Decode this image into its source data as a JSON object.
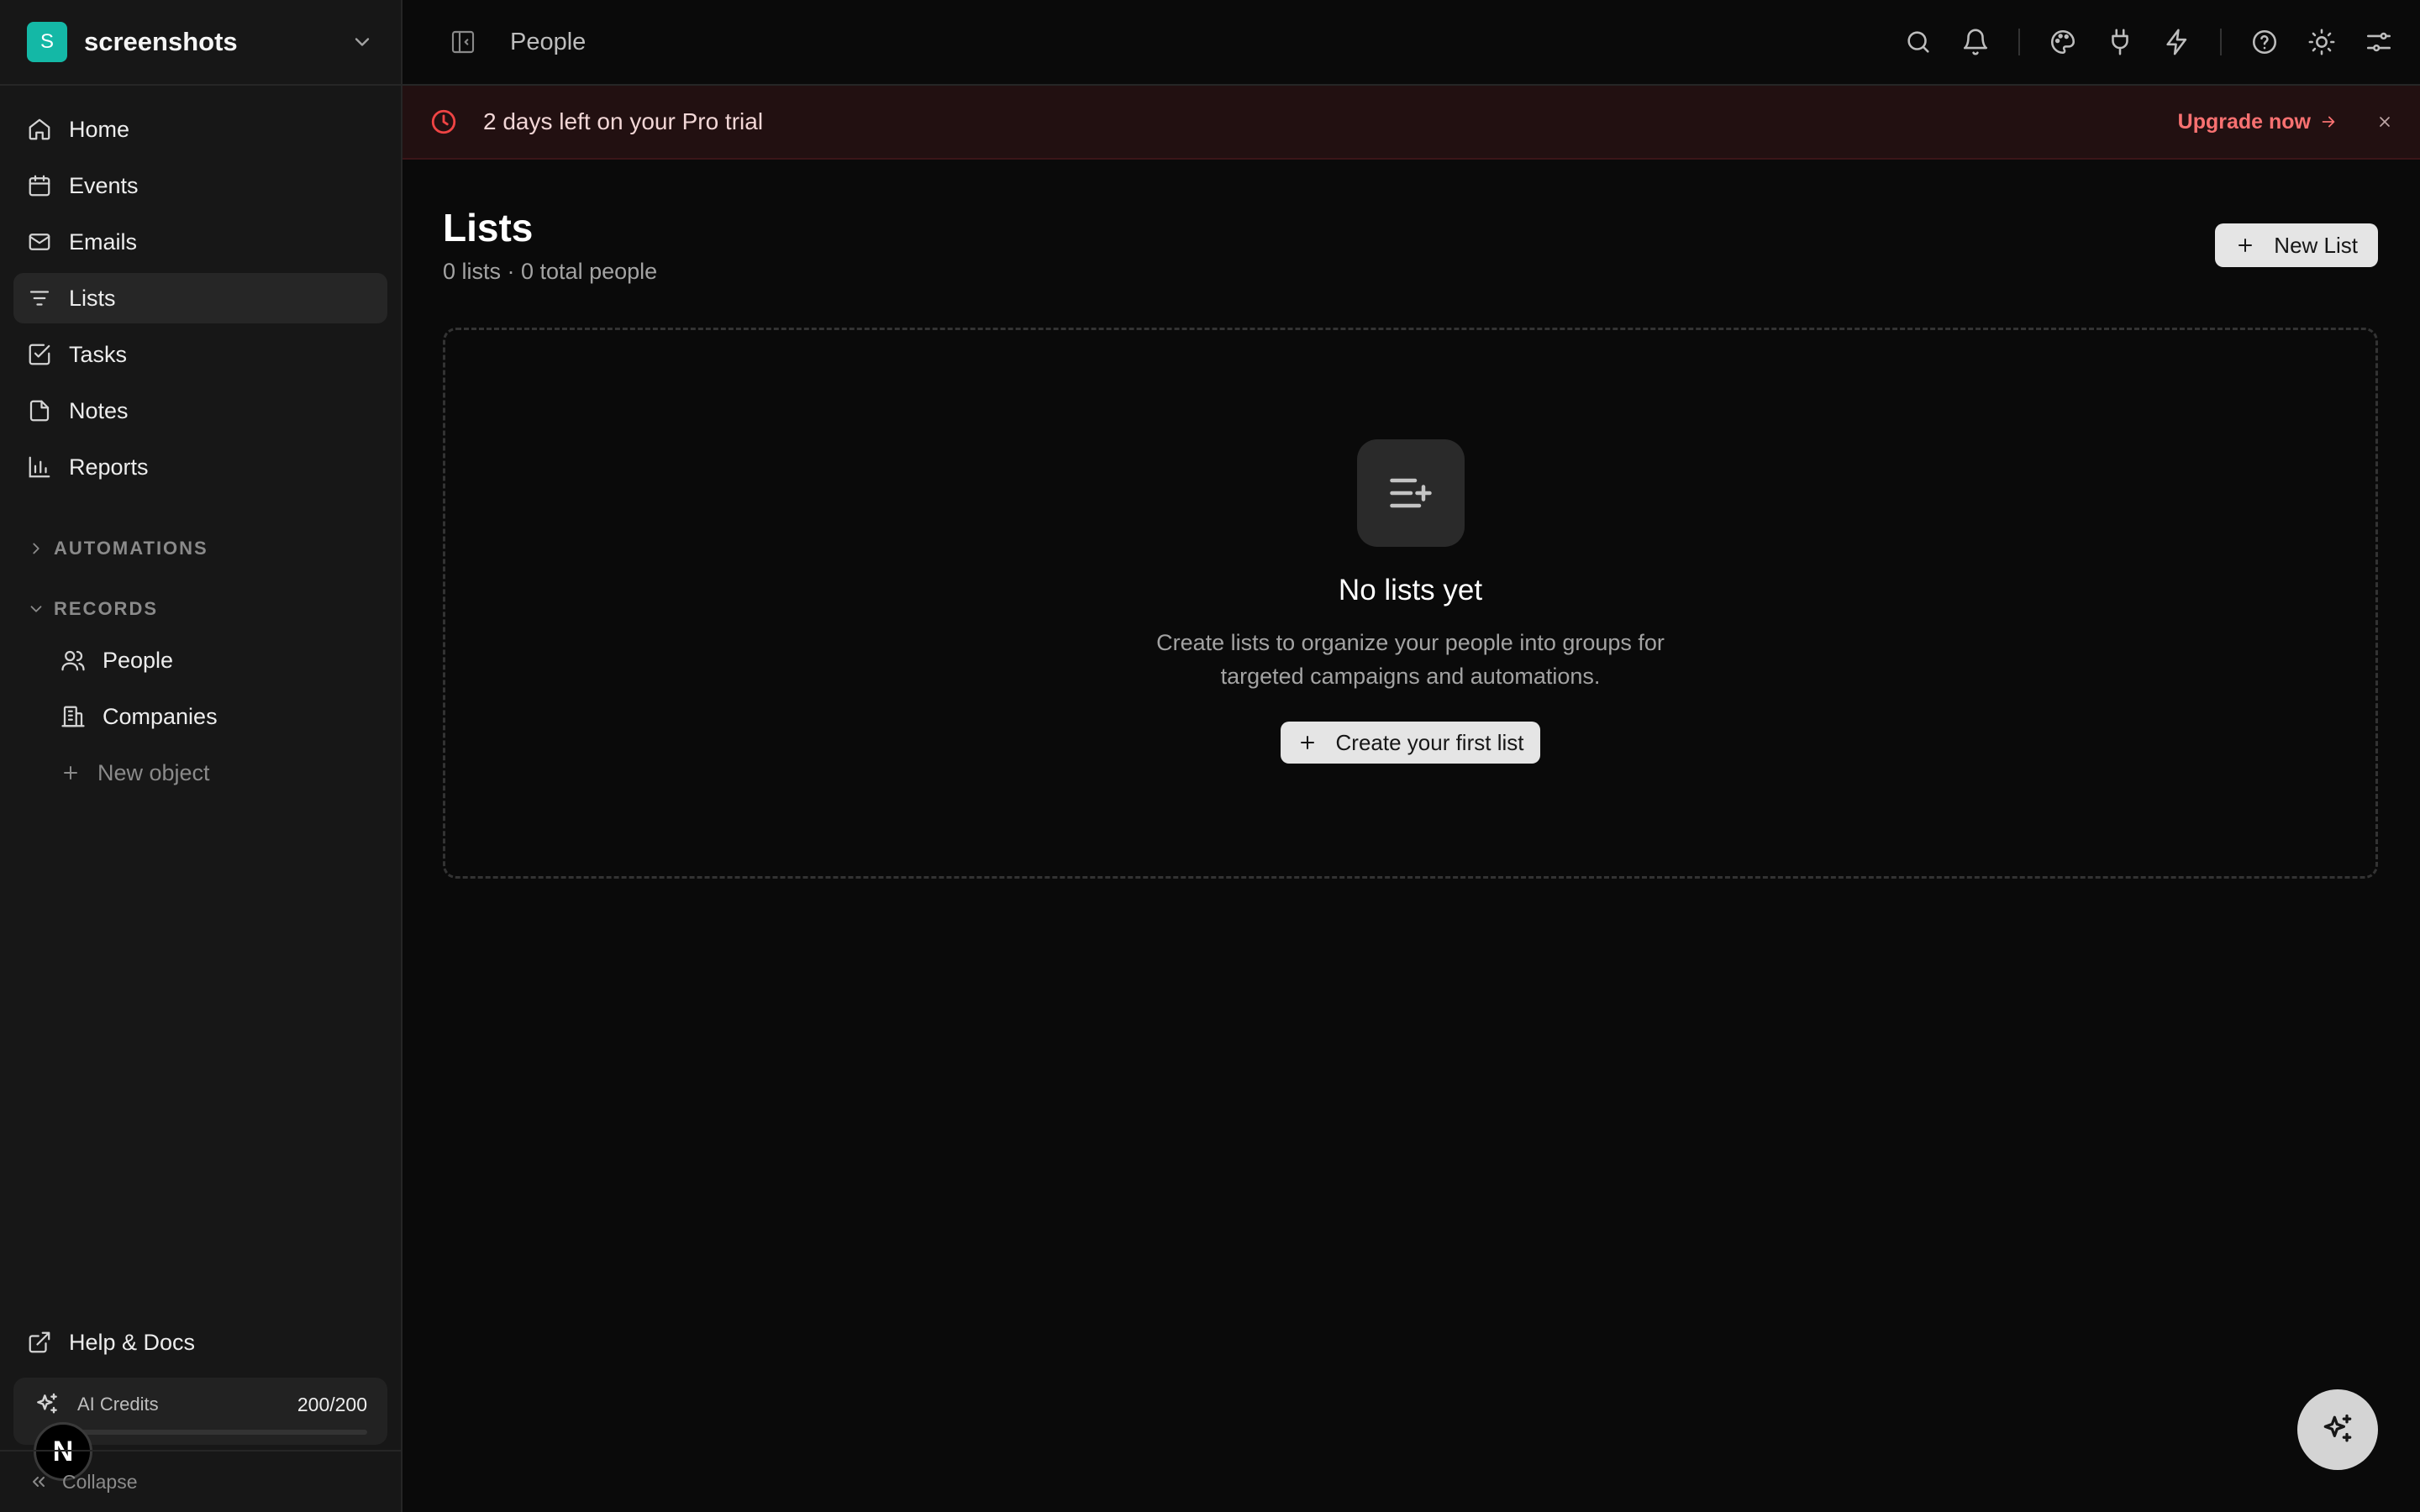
{
  "workspace": {
    "initial": "S",
    "name": "screenshots"
  },
  "nav": {
    "items": [
      {
        "label": "Home"
      },
      {
        "label": "Events"
      },
      {
        "label": "Emails"
      },
      {
        "label": "Lists"
      },
      {
        "label": "Tasks"
      },
      {
        "label": "Notes"
      },
      {
        "label": "Reports"
      }
    ]
  },
  "sections": {
    "automations": "AUTOMATIONS",
    "records": "RECORDS"
  },
  "records": {
    "items": [
      {
        "label": "People"
      },
      {
        "label": "Companies"
      },
      {
        "label": "New object"
      }
    ]
  },
  "footer": {
    "help": "Help & Docs",
    "credits_label": "AI Credits",
    "credits_value": "200/200",
    "credits_fraction": 0.0,
    "badge": "N",
    "collapse": "Collapse"
  },
  "topbar": {
    "breadcrumb": "People"
  },
  "banner": {
    "message": "2 days left on your Pro trial",
    "upgrade": "Upgrade now"
  },
  "page": {
    "title": "Lists",
    "subtitle": "0 lists · 0 total people",
    "new_list": "New List"
  },
  "empty": {
    "title": "No lists yet",
    "desc_line1": "Create lists to organize your people into groups for",
    "desc_line2": "targeted campaigns and automations.",
    "cta": "Create your first list"
  },
  "colors": {
    "accent_teal": "#14b8a6",
    "banner_red": "#ef4444",
    "upgrade_red": "#f87171"
  }
}
